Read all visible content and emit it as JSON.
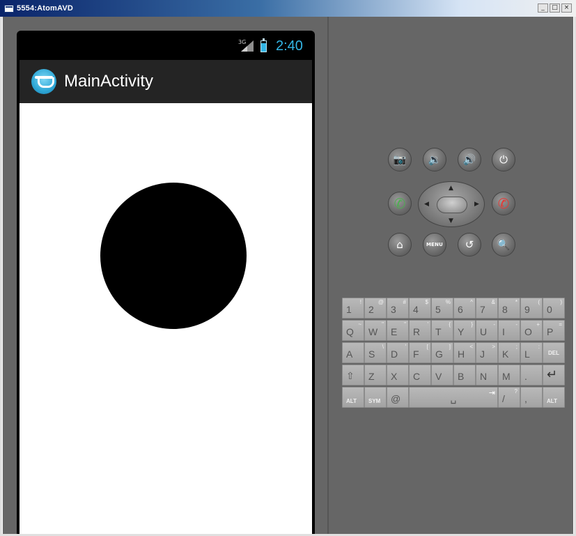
{
  "window": {
    "title": "5554:AtomAVD",
    "minimize_label": "_",
    "maximize_label": "□",
    "close_label": "×"
  },
  "status_bar": {
    "network": "3G",
    "time": "2:40",
    "signal_icon": "signal-icon",
    "battery_icon": "battery-icon"
  },
  "action_bar": {
    "title": "MainActivity",
    "icon": "app-icon"
  },
  "content": {
    "shape": "circle",
    "fill_color": "#000000"
  },
  "hardware_buttons": {
    "camera_glyph": "📷",
    "volume_down_glyph": "🔉",
    "volume_up_glyph": "🔊",
    "power_glyph": "⏻",
    "call_glyph": "✆",
    "end_call_glyph": "✆",
    "home_glyph": "⌂",
    "menu_label": "MENU",
    "back_glyph": "↺",
    "search_glyph": "🔍",
    "dpad_up": "▲",
    "dpad_down": "▼",
    "dpad_left": "◀",
    "dpad_right": "▶"
  },
  "keyboard": {
    "row1": [
      {
        "main": "1",
        "alt": "!"
      },
      {
        "main": "2",
        "alt": "@"
      },
      {
        "main": "3",
        "alt": "#"
      },
      {
        "main": "4",
        "alt": "$"
      },
      {
        "main": "5",
        "alt": "%"
      },
      {
        "main": "6",
        "alt": "^"
      },
      {
        "main": "7",
        "alt": "&"
      },
      {
        "main": "8",
        "alt": "*"
      },
      {
        "main": "9",
        "alt": "("
      },
      {
        "main": "0",
        "alt": ")"
      }
    ],
    "row2": [
      {
        "main": "Q",
        "alt": "~"
      },
      {
        "main": "W",
        "alt": "\""
      },
      {
        "main": "E",
        "alt": "\""
      },
      {
        "main": "R",
        "alt": "'"
      },
      {
        "main": "T",
        "alt": "{"
      },
      {
        "main": "Y",
        "alt": "}"
      },
      {
        "main": "U",
        "alt": "-"
      },
      {
        "main": "I",
        "alt": "-"
      },
      {
        "main": "O",
        "alt": "+"
      },
      {
        "main": "P",
        "alt": "="
      }
    ],
    "row3": [
      {
        "main": "A",
        "alt": ""
      },
      {
        "main": "S",
        "alt": "\\"
      },
      {
        "main": "D",
        "alt": "'"
      },
      {
        "main": "F",
        "alt": "["
      },
      {
        "main": "G",
        "alt": "]"
      },
      {
        "main": "H",
        "alt": "<"
      },
      {
        "main": "J",
        "alt": ">"
      },
      {
        "main": "K",
        "alt": ";"
      },
      {
        "main": "L",
        "alt": ":"
      },
      {
        "main": "DEL",
        "alt": ""
      }
    ],
    "row4": [
      {
        "main": "⇧",
        "alt": ""
      },
      {
        "main": "Z",
        "alt": ""
      },
      {
        "main": "X",
        "alt": ""
      },
      {
        "main": "C",
        "alt": ""
      },
      {
        "main": "V",
        "alt": ""
      },
      {
        "main": "B",
        "alt": ""
      },
      {
        "main": "N",
        "alt": ""
      },
      {
        "main": "M",
        "alt": ""
      },
      {
        "main": ".",
        "alt": ""
      },
      {
        "main": "↵",
        "alt": ""
      }
    ],
    "row5": {
      "alt_left": "ALT",
      "sym": "SYM",
      "at": "@",
      "space": "␣",
      "tab_glyph": "⇥",
      "slash": "/",
      "question": "?",
      "comma": ",",
      "alt_right": "ALT"
    }
  },
  "colors": {
    "accent": "#33b5e5",
    "panel_bg": "#666666",
    "screen_bg": "#ffffff"
  }
}
